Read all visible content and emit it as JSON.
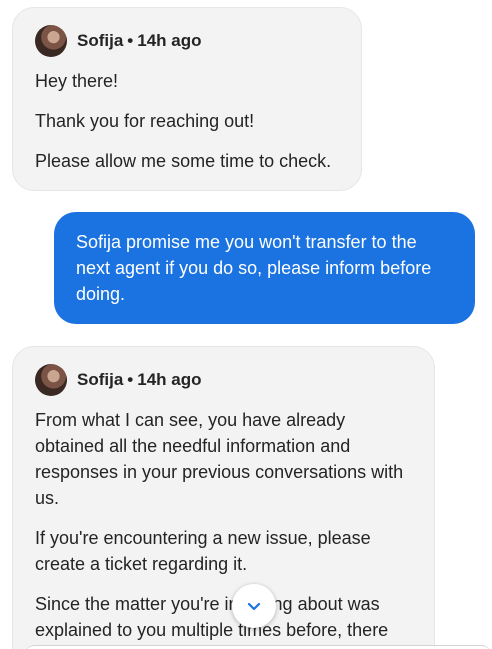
{
  "messages": [
    {
      "author": "Sofija",
      "separator": "•",
      "time": "14h ago",
      "paragraphs": [
        "Hey there!",
        "Thank you for reaching out!",
        "Please allow me some time to check."
      ]
    },
    {
      "text": "Sofija promise me you won't transfer to the next agent if you do so, please inform before doing."
    },
    {
      "author": "Sofija",
      "separator": "•",
      "time": "14h ago",
      "paragraphs": [
        "From what I can see, you have already obtained all the needful information and responses in your previous conversations with us.",
        "If you're encountering a new issue, please create a ticket regarding it.",
        "Since the matter you're inquiring about was explained to you multiple times before, there"
      ]
    }
  ],
  "colors": {
    "agent_bubble": "#f3f3f3",
    "user_bubble": "#1a73e0",
    "scroll_icon": "#1a73e0"
  },
  "icons": {
    "scroll": "chevron-down-icon",
    "avatar": "agent-avatar"
  }
}
